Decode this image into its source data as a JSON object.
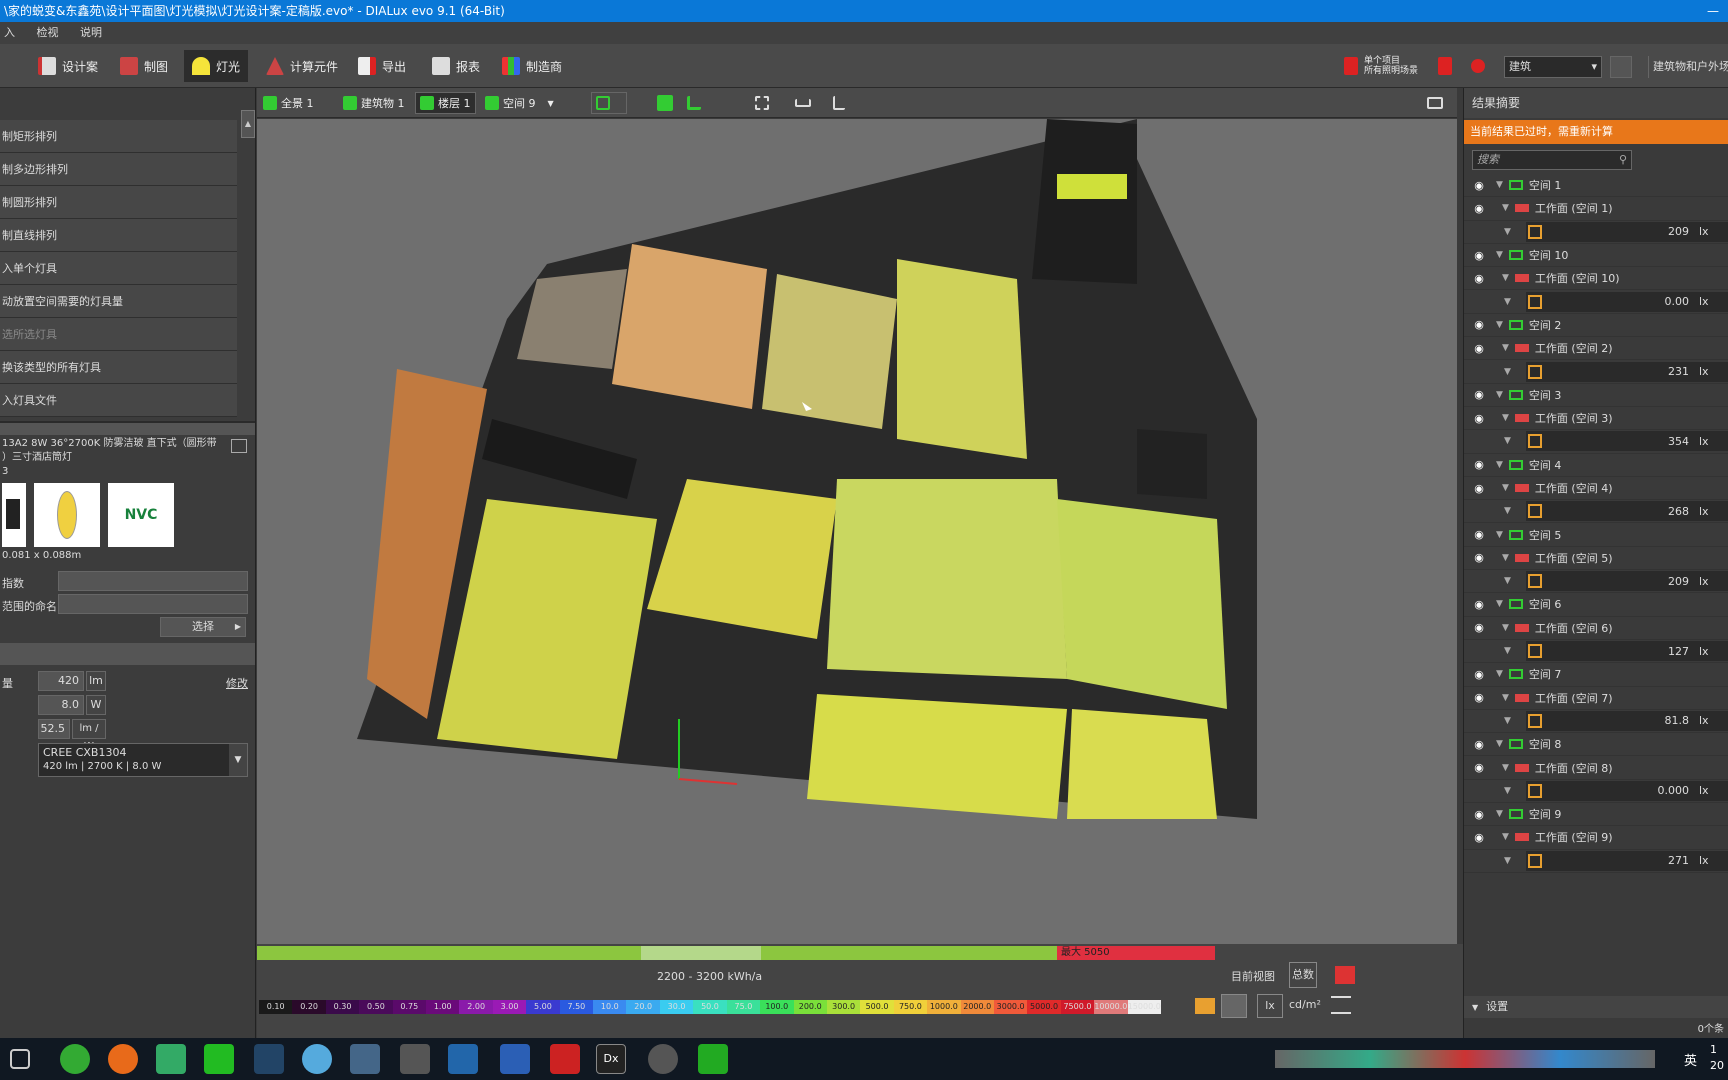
{
  "title": "\\家的蜕变&东鑫苑\\设计平面图\\灯光模拟\\灯光设计案-定稿版.evo* - DIALux evo 9.1  (64-Bit)",
  "menu": [
    "入",
    "检视",
    "说明"
  ],
  "toolbar": {
    "items": [
      "设计案",
      "制图",
      "灯光",
      "计算元件",
      "导出",
      "报表",
      "制造商"
    ],
    "active": "灯光",
    "right_btn1": "单个项目\n所有照明场景",
    "dropdown_value": "建筑",
    "right_label": "建筑物和户外场"
  },
  "view_toolbar": {
    "items": [
      "全景 1",
      "建筑物 1",
      "楼层 1",
      "空间 9"
    ],
    "active": "楼层 1"
  },
  "left_panel": {
    "actions": [
      "制矩形排列",
      "制多边形排列",
      "制圆形排列",
      "制直线排列",
      "入单个灯具",
      "动放置空间需要的灯具量",
      "选所选灯具",
      "换该类型的所有灯具",
      "入灯具文件"
    ],
    "dim_index": 6,
    "luminaire_title_line1": "13A2 8W 36°2700K 防雾洁玻 直下式（圆形带",
    "luminaire_title_line2": "）三寸酒店筒灯",
    "luminaire_title_line3": "3",
    "dimension": "0.081 x 0.088m",
    "brand_text": "NVC",
    "field1_label": "指数",
    "field2_label": "范围的命名",
    "select_btn": "选择",
    "flux_label": "量",
    "flux_value": "420",
    "flux_unit": "lm",
    "edit_link": "修改",
    "power_value": "8.0",
    "power_unit": "W",
    "efficacy_value": "52.5",
    "efficacy_unit": "lm / W",
    "lamp_name": "CREE CXB1304",
    "lamp_info": "420 lm  |  2700 K  |  8.0 W"
  },
  "right_panel": {
    "header": "结果摘要",
    "warning": "当前结果已过时，需重新计算",
    "search_placeholder": "搜索",
    "spaces": [
      {
        "name": "空间 1",
        "plane": "工作面 (空间 1)",
        "value": "209",
        "unit": "lx"
      },
      {
        "name": "空间 10",
        "plane": "工作面 (空间 10)",
        "value": "0.00",
        "unit": "lx"
      },
      {
        "name": "空间 2",
        "plane": "工作面 (空间 2)",
        "value": "231",
        "unit": "lx"
      },
      {
        "name": "空间 3",
        "plane": "工作面 (空间 3)",
        "value": "354",
        "unit": "lx"
      },
      {
        "name": "空间 4",
        "plane": "工作面 (空间 4)",
        "value": "268",
        "unit": "lx"
      },
      {
        "name": "空间 5",
        "plane": "工作面 (空间 5)",
        "value": "209",
        "unit": "lx"
      },
      {
        "name": "空间 6",
        "plane": "工作面 (空间 6)",
        "value": "127",
        "unit": "lx"
      },
      {
        "name": "空间 7",
        "plane": "工作面 (空间 7)",
        "value": "81.8",
        "unit": "lx"
      },
      {
        "name": "空间 8",
        "plane": "工作面 (空间 8)",
        "value": "0.000",
        "unit": "lx"
      },
      {
        "name": "空间 9",
        "plane": "工作面 (空间 9)",
        "value": "271",
        "unit": "lx"
      }
    ],
    "settings": "设置",
    "footer": "0个条"
  },
  "statusbar": {
    "energy_range": "2200 - 3200 kWh/a",
    "max_label": "最大 5050",
    "view_label": "目前视图",
    "total_btn": "总数",
    "unit_lx": "lx",
    "unit_cd": "cd/m²",
    "scale": [
      "0.10",
      "0.20",
      "0.30",
      "0.50",
      "0.75",
      "1.00",
      "2.00",
      "3.00",
      "5.00",
      "7.50",
      "10.0",
      "20.0",
      "30.0",
      "50.0",
      "75.0",
      "100.0",
      "200.0",
      "300.0",
      "500.0",
      "750.0",
      "1000.0",
      "2000.0",
      "3000.0",
      "5000.0",
      "7500.0",
      "10000.0",
      "15000.0"
    ],
    "scale_colors": [
      "#1a1a1a",
      "#2a0a2a",
      "#3a0a4a",
      "#4a0a5a",
      "#5a0a6a",
      "#6a0a7a",
      "#8a1aaa",
      "#9a1ab5",
      "#3a3ad0",
      "#2a5ae0",
      "#3a8af0",
      "#3aaaf0",
      "#3accf0",
      "#3ae0c0",
      "#3ae09a",
      "#3ae05a",
      "#7ae03a",
      "#aae03a",
      "#e0e03a",
      "#f0d03a",
      "#f0b03a",
      "#f08a3a",
      "#f05a3a",
      "#e02a2a",
      "#d01a2a",
      "#e07a7a",
      "#eeeeee"
    ]
  },
  "taskbar": {
    "lang": "英",
    "time": "1",
    "date": "20"
  }
}
